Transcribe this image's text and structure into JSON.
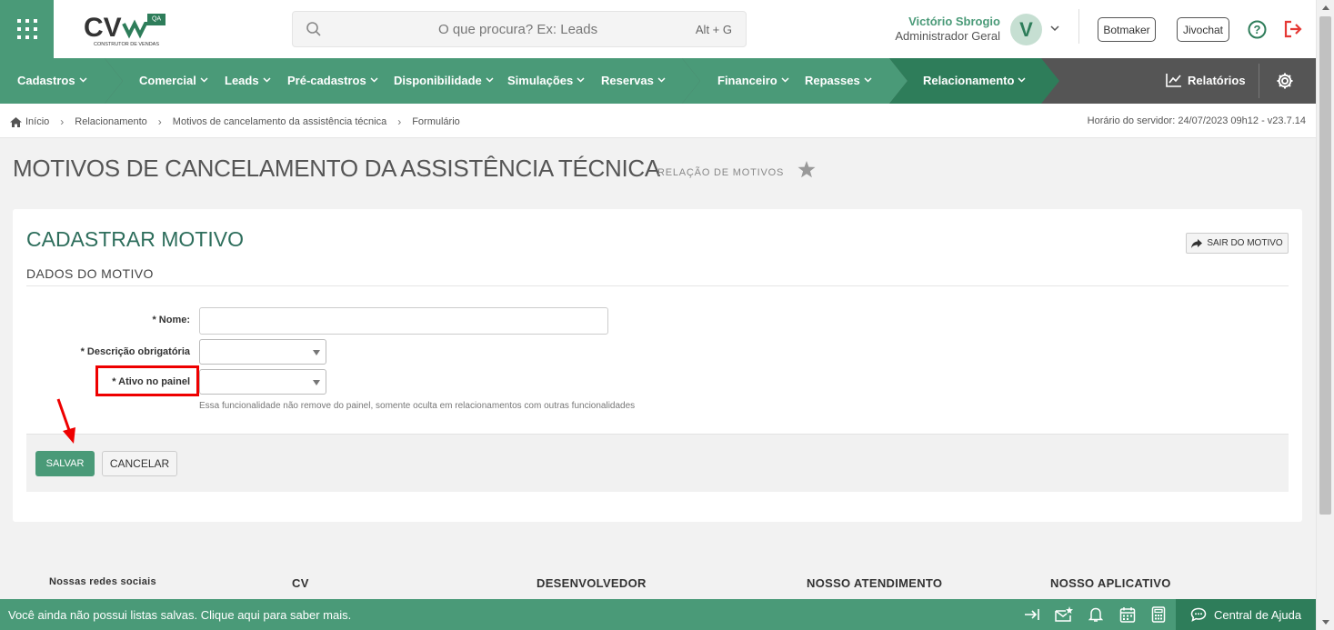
{
  "colors": {
    "brand_green": "#4a9a78",
    "dark_green": "#2e7d5a",
    "menu_gray": "#555555",
    "highlight_red": "#e00000"
  },
  "header": {
    "apps_icon": "grid-icon",
    "logo": {
      "text": "CV",
      "badge": "QA",
      "tagline": "CONSTRUTOR DE VENDAS"
    },
    "search": {
      "placeholder": "O que procura? Ex: Leads",
      "shortcut": "Alt + G"
    },
    "user": {
      "name": "Victório Sbrogio",
      "role": "Administrador Geral",
      "initial": "V"
    },
    "buttons": {
      "botmaker": "Botmaker",
      "jivochat": "Jivochat"
    }
  },
  "menu": {
    "items": [
      {
        "label": "Cadastros"
      },
      {
        "label": "Comercial"
      },
      {
        "label": "Leads"
      },
      {
        "label": "Pré-cadastros"
      },
      {
        "label": "Disponibilidade"
      },
      {
        "label": "Simulações"
      },
      {
        "label": "Reservas"
      },
      {
        "label": "Financeiro"
      },
      {
        "label": "Repasses"
      },
      {
        "label": "Relacionamento"
      }
    ],
    "reports": "Relatórios"
  },
  "breadcrumb": {
    "items": [
      "Início",
      "Relacionamento",
      "Motivos de cancelamento da assistência técnica",
      "Formulário"
    ],
    "server_time": "Horário do servidor: 24/07/2023 09h12 - v23.7.14"
  },
  "page": {
    "title": "MOTIVOS DE CANCELAMENTO DA ASSISTÊNCIA TÉCNICA",
    "subtitle": "RELAÇÃO DE MOTIVOS"
  },
  "form": {
    "title": "CADASTRAR MOTIVO",
    "exit_label": "SAIR DO MOTIVO",
    "section": "DADOS DO MOTIVO",
    "fields": {
      "nome": {
        "label": "* Nome:",
        "value": ""
      },
      "descricao": {
        "label": "* Descrição obrigatória",
        "value": ""
      },
      "ativo": {
        "label": "* Ativo no painel",
        "value": ""
      }
    },
    "hint": "Essa funcionalidade não remove do painel, somente oculta em relacionamentos com outras funcionalidades",
    "save": "SALVAR",
    "cancel": "CANCELAR"
  },
  "footer": {
    "social": "Nossas redes sociais",
    "cv": "CV",
    "developer": "DESENVOLVEDOR",
    "support": "NOSSO ATENDIMENTO",
    "app": "NOSSO APLICATIVO"
  },
  "bottombar": {
    "message": "Você ainda não possui listas salvas. Clique aqui para saber mais.",
    "help_center": "Central de Ajuda"
  }
}
